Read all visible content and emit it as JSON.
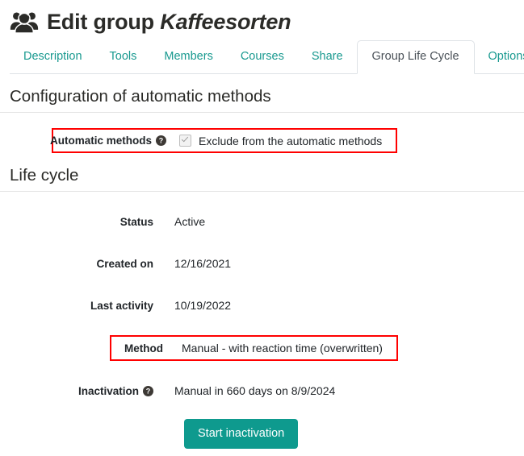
{
  "header": {
    "icon": "users-group-icon",
    "title_prefix": "Edit group",
    "title_group_name": "Kaffeesorten"
  },
  "tabs": {
    "items": [
      {
        "label": "Description",
        "active": false
      },
      {
        "label": "Tools",
        "active": false
      },
      {
        "label": "Members",
        "active": false
      },
      {
        "label": "Courses",
        "active": false
      },
      {
        "label": "Share",
        "active": false
      },
      {
        "label": "Group Life Cycle",
        "active": true
      },
      {
        "label": "Options",
        "active": false
      }
    ]
  },
  "automatic_methods_section": {
    "heading": "Configuration of automatic methods",
    "row": {
      "label": "Automatic methods",
      "help_icon": "question-mark-circle-icon",
      "checkbox_checked": true,
      "checkbox_disabled": true,
      "checkbox_label": "Exclude from the automatic methods"
    }
  },
  "life_cycle_section": {
    "heading": "Life cycle",
    "rows": [
      {
        "label": "Status",
        "value": "Active",
        "help_icon": null,
        "highlighted": false
      },
      {
        "label": "Created on",
        "value": "12/16/2021",
        "help_icon": null,
        "highlighted": false
      },
      {
        "label": "Last activity",
        "value": "10/19/2022",
        "help_icon": null,
        "highlighted": false
      },
      {
        "label": "Method",
        "value": "Manual - with reaction time (overwritten)",
        "help_icon": null,
        "highlighted": true
      },
      {
        "label": "Inactivation",
        "value": "Manual in 660 days on 8/9/2024",
        "help_icon": "question-mark-circle-icon",
        "highlighted": false
      }
    ],
    "action_button": "Start inactivation"
  },
  "colors": {
    "accent_teal": "#0e9a8e",
    "link_teal": "#18998f",
    "highlight_red": "#ff0000",
    "text": "#212529",
    "rule": "#e4e4e4",
    "tab_border": "#dee2e6"
  }
}
